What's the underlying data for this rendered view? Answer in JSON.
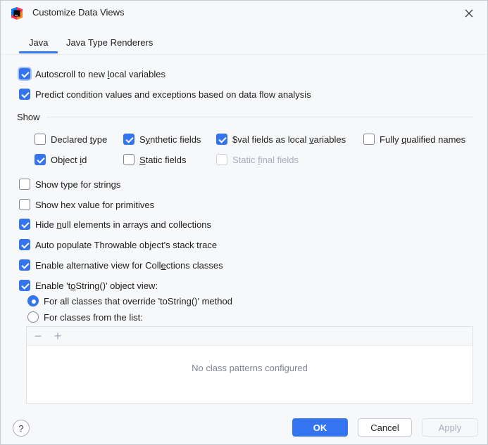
{
  "window": {
    "title": "Customize Data Views",
    "app_icon": "intellij-app-icon",
    "close_icon": "close-icon"
  },
  "tabs": [
    {
      "label": "Java",
      "selected": true
    },
    {
      "label": "Java Type Renderers",
      "selected": false
    }
  ],
  "general": [
    {
      "label": "Autoscroll to new local variables",
      "checked": true
    },
    {
      "label": "Predict condition values and exceptions based on data flow analysis",
      "checked": true
    }
  ],
  "show_group": {
    "label": "Show",
    "items": [
      {
        "label": "Declared type",
        "checked": false,
        "enabled": true
      },
      {
        "label": "Synthetic fields",
        "checked": true,
        "enabled": true
      },
      {
        "label": "$val fields as local variables",
        "checked": true,
        "enabled": true
      },
      {
        "label": "Fully qualified names",
        "checked": false,
        "enabled": true
      },
      {
        "label": "Object id",
        "checked": true,
        "enabled": true
      },
      {
        "label": "Static fields",
        "checked": false,
        "enabled": true
      },
      {
        "label": "Static final fields",
        "checked": false,
        "enabled": false
      }
    ]
  },
  "options": [
    {
      "label": "Show type for strings",
      "checked": false
    },
    {
      "label": "Show hex value for primitives",
      "checked": false
    },
    {
      "label": "Hide null elements in arrays and collections",
      "checked": true
    },
    {
      "label": "Auto populate Throwable object's stack trace",
      "checked": true
    },
    {
      "label": "Enable alternative view for Collections classes",
      "checked": true
    },
    {
      "label": "Enable 'toString()' object view:",
      "checked": true
    }
  ],
  "tostring_mode": {
    "options": [
      {
        "label": "For all classes that override 'toString()' method",
        "selected": true
      },
      {
        "label": "For classes from the list:",
        "selected": false
      }
    ]
  },
  "class_list": {
    "remove_glyph": "−",
    "add_glyph": "+",
    "empty_text": "No class patterns configured"
  },
  "footer": {
    "help_label": "?",
    "ok_label": "OK",
    "cancel_label": "Cancel",
    "apply_label": "Apply"
  },
  "colors": {
    "accent": "#3574f0",
    "background": "#f7f8fa",
    "disabled_text": "#a8adbd"
  }
}
